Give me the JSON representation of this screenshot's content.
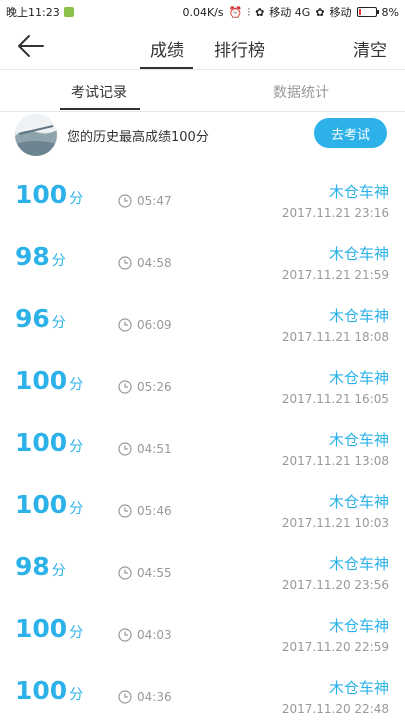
{
  "status_bar": {
    "time": "晚上11:23",
    "net_speed": "0.04K/s",
    "carrier_1": "移动 4G",
    "carrier_2": "移动",
    "battery": "8%",
    "icons": [
      "wechat-icon",
      "alarm-icon",
      "signal-icon",
      "flower-icon",
      "flower-icon",
      "battery-icon"
    ]
  },
  "nav": {
    "tab_score": "成绩",
    "tab_rank": "排行榜",
    "clear_label": "清空"
  },
  "subtabs": {
    "exam_records": "考试记录",
    "data_stats": "数据统计"
  },
  "best": {
    "text": "您的历史最高成绩100分",
    "button_label": "去考试"
  },
  "score_unit": "分",
  "records": [
    {
      "score": "100",
      "duration": "05:47",
      "name": "木仓车神",
      "date": "2017.11.21  23:16"
    },
    {
      "score": "98",
      "duration": "04:58",
      "name": "木仓车神",
      "date": "2017.11.21  21:59"
    },
    {
      "score": "96",
      "duration": "06:09",
      "name": "木仓车神",
      "date": "2017.11.21  18:08"
    },
    {
      "score": "100",
      "duration": "05:26",
      "name": "木仓车神",
      "date": "2017.11.21  16:05"
    },
    {
      "score": "100",
      "duration": "04:51",
      "name": "木仓车神",
      "date": "2017.11.21  13:08"
    },
    {
      "score": "100",
      "duration": "05:46",
      "name": "木仓车神",
      "date": "2017.11.21  10:03"
    },
    {
      "score": "98",
      "duration": "04:55",
      "name": "木仓车神",
      "date": "2017.11.20  23:56"
    },
    {
      "score": "100",
      "duration": "04:03",
      "name": "木仓车神",
      "date": "2017.11.20  22:59"
    },
    {
      "score": "100",
      "duration": "04:36",
      "name": "木仓车神",
      "date": "2017.11.20  22:48"
    }
  ],
  "colors": {
    "accent": "#2cb2e9",
    "muted": "#999999"
  }
}
